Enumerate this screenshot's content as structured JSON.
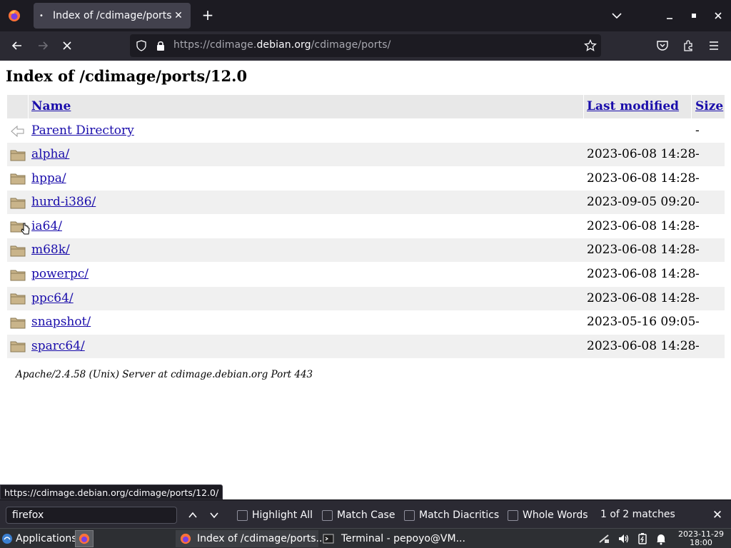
{
  "browser": {
    "tab_title": "Index of /cdimage/ports",
    "url_prefix": "https://cdimage.",
    "url_domain": "debian.org",
    "url_path": "/cdimage/ports/"
  },
  "page": {
    "title": "Index of /cdimage/ports/12.0",
    "headers": {
      "name": "Name",
      "modified": "Last modified",
      "size": "Size"
    },
    "parent": {
      "name": "Parent Directory",
      "size": "-"
    },
    "rows": [
      {
        "name": "alpha/",
        "modified": "2023-06-08 14:28",
        "size": "-"
      },
      {
        "name": "hppa/",
        "modified": "2023-06-08 14:28",
        "size": "-"
      },
      {
        "name": "hurd-i386/",
        "modified": "2023-09-05 09:20",
        "size": "-"
      },
      {
        "name": "ia64/",
        "modified": "2023-06-08 14:28",
        "size": "-"
      },
      {
        "name": "m68k/",
        "modified": "2023-06-08 14:28",
        "size": "-"
      },
      {
        "name": "powerpc/",
        "modified": "2023-06-08 14:28",
        "size": "-"
      },
      {
        "name": "ppc64/",
        "modified": "2023-06-08 14:28",
        "size": "-"
      },
      {
        "name": "snapshot/",
        "modified": "2023-05-16 09:05",
        "size": "-"
      },
      {
        "name": "sparc64/",
        "modified": "2023-06-08 14:28",
        "size": "-"
      }
    ],
    "server_signature": "Apache/2.4.58 (Unix) Server at cdimage.debian.org Port 443"
  },
  "status_url": "https://cdimage.debian.org/cdimage/ports/12.0/",
  "findbar": {
    "query": "firefox",
    "highlight_all": "Highlight All",
    "match_case": "Match Case",
    "match_diacritics": "Match Diacritics",
    "whole_words": "Whole Words",
    "matches": "1 of 2 matches"
  },
  "taskbar": {
    "applications": "Applications",
    "task_firefox": "Index of /cdimage/ports...",
    "task_terminal": "Terminal - pepoyo@VM...",
    "clock_date": "2023-11-29",
    "clock_time": "18:00"
  },
  "colors": {
    "link": "#1a0dab",
    "chrome_dark": "#1c1b22",
    "chrome": "#2b2a33",
    "row_alt": "#f0f0f0"
  }
}
